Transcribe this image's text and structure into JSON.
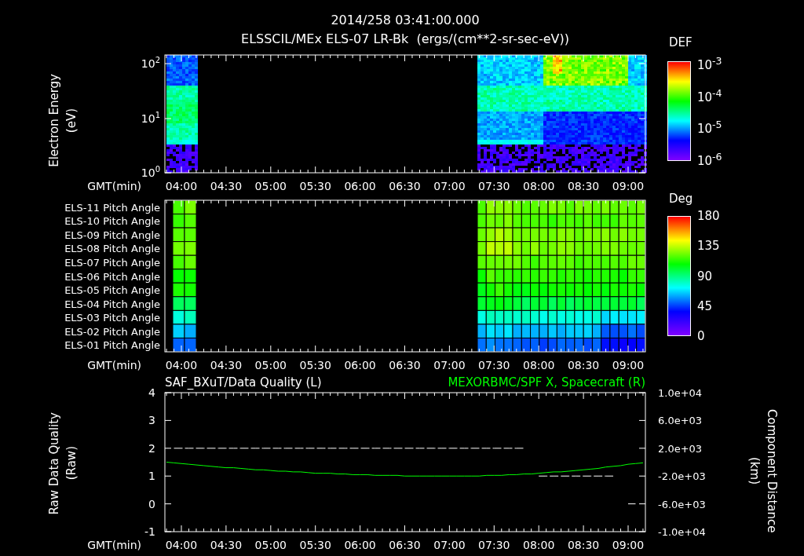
{
  "header": {
    "lines": [
      "2014/258 03:41:00.000",
      "ELSSCIL/MEx ELS-07 LR-Bk  (ergs/(cm**2-sr-sec-eV))"
    ]
  },
  "energy_panel": {
    "ylabel": [
      "Electron Energy",
      "(eV)"
    ],
    "yticks": [
      "10$^{2}$",
      "10$^{1}$",
      "10$^{0}$"
    ],
    "xlabel": "GMT(min)",
    "xticks": [
      "04:00",
      "04:30",
      "05:00",
      "05:30",
      "06:00",
      "06:30",
      "07:00",
      "07:30",
      "08:00",
      "08:30",
      "09:00"
    ],
    "colorbar": {
      "title": "DEF",
      "ticks": [
        "10$^{-3}$",
        "10$^{-4}$",
        "10$^{-5}$",
        "10$^{-6}$"
      ]
    }
  },
  "pitch_panel": {
    "rows": [
      "ELS-11 Pitch Angle",
      "ELS-10 Pitch Angle",
      "ELS-09 Pitch Angle",
      "ELS-08 Pitch Angle",
      "ELS-07 Pitch Angle",
      "ELS-06 Pitch Angle",
      "ELS-05 Pitch Angle",
      "ELS-04 Pitch Angle",
      "ELS-03 Pitch Angle",
      "ELS-02 Pitch Angle",
      "ELS-01 Pitch Angle"
    ],
    "xlabel": "GMT(min)",
    "xticks": [
      "04:00",
      "04:30",
      "05:00",
      "05:30",
      "06:00",
      "06:30",
      "07:00",
      "07:30",
      "08:00",
      "08:30",
      "09:00"
    ],
    "colorbar": {
      "title": "Deg",
      "ticks": [
        "180",
        "135",
        "90",
        "45",
        "0"
      ]
    }
  },
  "quality_panel": {
    "title_left": "SAF_BXuT/Data Quality (L)",
    "title_right": "MEXORBMC/SPF X, Spacecraft (R)",
    "ylabel": [
      "Raw Data Quality",
      "(Raw)"
    ],
    "y2label": [
      "Component Distance",
      "(km)"
    ],
    "xlabel": "GMT(min)",
    "chart_data": {
      "type": "line",
      "categories": [
        null,
        null,
        "04:00",
        null,
        null,
        null,
        null,
        null,
        "04:30",
        null,
        null,
        null,
        null,
        null,
        "05:00",
        null,
        null,
        null,
        null,
        null,
        "05:30",
        null,
        null,
        null,
        null,
        null,
        "06:00",
        null,
        null,
        null,
        null,
        null,
        "06:30",
        null,
        null,
        null,
        null,
        null,
        "07:00",
        null,
        null,
        null,
        null,
        null,
        "07:30",
        null,
        null,
        null,
        null,
        null,
        "08:00",
        null,
        null,
        null,
        null,
        null,
        "08:30",
        null,
        null,
        null,
        null,
        null,
        "09:00",
        null,
        null
      ],
      "ylim": [
        -1,
        4
      ],
      "y2lim": [
        -10000,
        10000
      ],
      "yticks": [
        {
          "value": 4,
          "label": "4"
        },
        {
          "value": 3,
          "label": "3"
        },
        {
          "value": 2,
          "label": "2"
        },
        {
          "value": 1,
          "label": "1"
        },
        {
          "value": 0,
          "label": "0"
        },
        {
          "value": -1,
          "label": "-1"
        }
      ],
      "y2ticks": [
        {
          "value": 10000,
          "label": "1.0e+04"
        },
        {
          "value": 6000,
          "label": "6.0e+03"
        },
        {
          "value": 2000,
          "label": "2.0e+03"
        },
        {
          "value": -2000,
          "label": "-2.0e+03"
        },
        {
          "value": -6000,
          "label": "-6.0e+03"
        },
        {
          "value": -10000,
          "label": "-1.0e+04"
        }
      ],
      "series": [
        {
          "color": "#ffffff",
          "line_style": "dashed",
          "values": [
            null,
            2,
            2,
            2,
            2,
            2,
            2,
            2,
            2,
            2,
            2,
            2,
            2,
            2,
            2,
            2,
            2,
            2,
            2,
            2,
            2,
            2,
            2,
            2,
            2,
            2,
            2,
            2,
            2,
            2,
            2,
            2,
            2,
            2,
            2,
            2,
            2,
            2,
            2,
            2,
            2,
            2,
            2,
            2,
            2,
            2,
            2,
            2,
            2,
            null,
            1,
            1,
            1,
            1,
            1,
            1,
            1,
            1,
            1,
            1,
            1,
            null,
            0,
            0,
            null
          ]
        },
        {
          "color": "#00ff00",
          "axis": "y2",
          "values": [
            0,
            -100,
            -200,
            -300,
            -400,
            -500,
            -600,
            -700,
            -800,
            -800,
            -900,
            -1000,
            -1100,
            -1100,
            -1200,
            -1300,
            -1300,
            -1400,
            -1400,
            -1500,
            -1600,
            -1600,
            -1600,
            -1700,
            -1700,
            -1800,
            -1800,
            -1800,
            -1900,
            -1900,
            -1900,
            -1900,
            -2000,
            -2000,
            -2000,
            -2000,
            -2000,
            -2000,
            -2000,
            -2000,
            -2000,
            -2000,
            -2000,
            -1900,
            -1900,
            -1900,
            -1800,
            -1800,
            -1700,
            -1700,
            -1600,
            -1500,
            -1400,
            -1400,
            -1300,
            -1200,
            -1100,
            -1000,
            -900,
            -700,
            -600,
            -500,
            -300,
            -200,
            -100
          ]
        }
      ]
    }
  }
}
